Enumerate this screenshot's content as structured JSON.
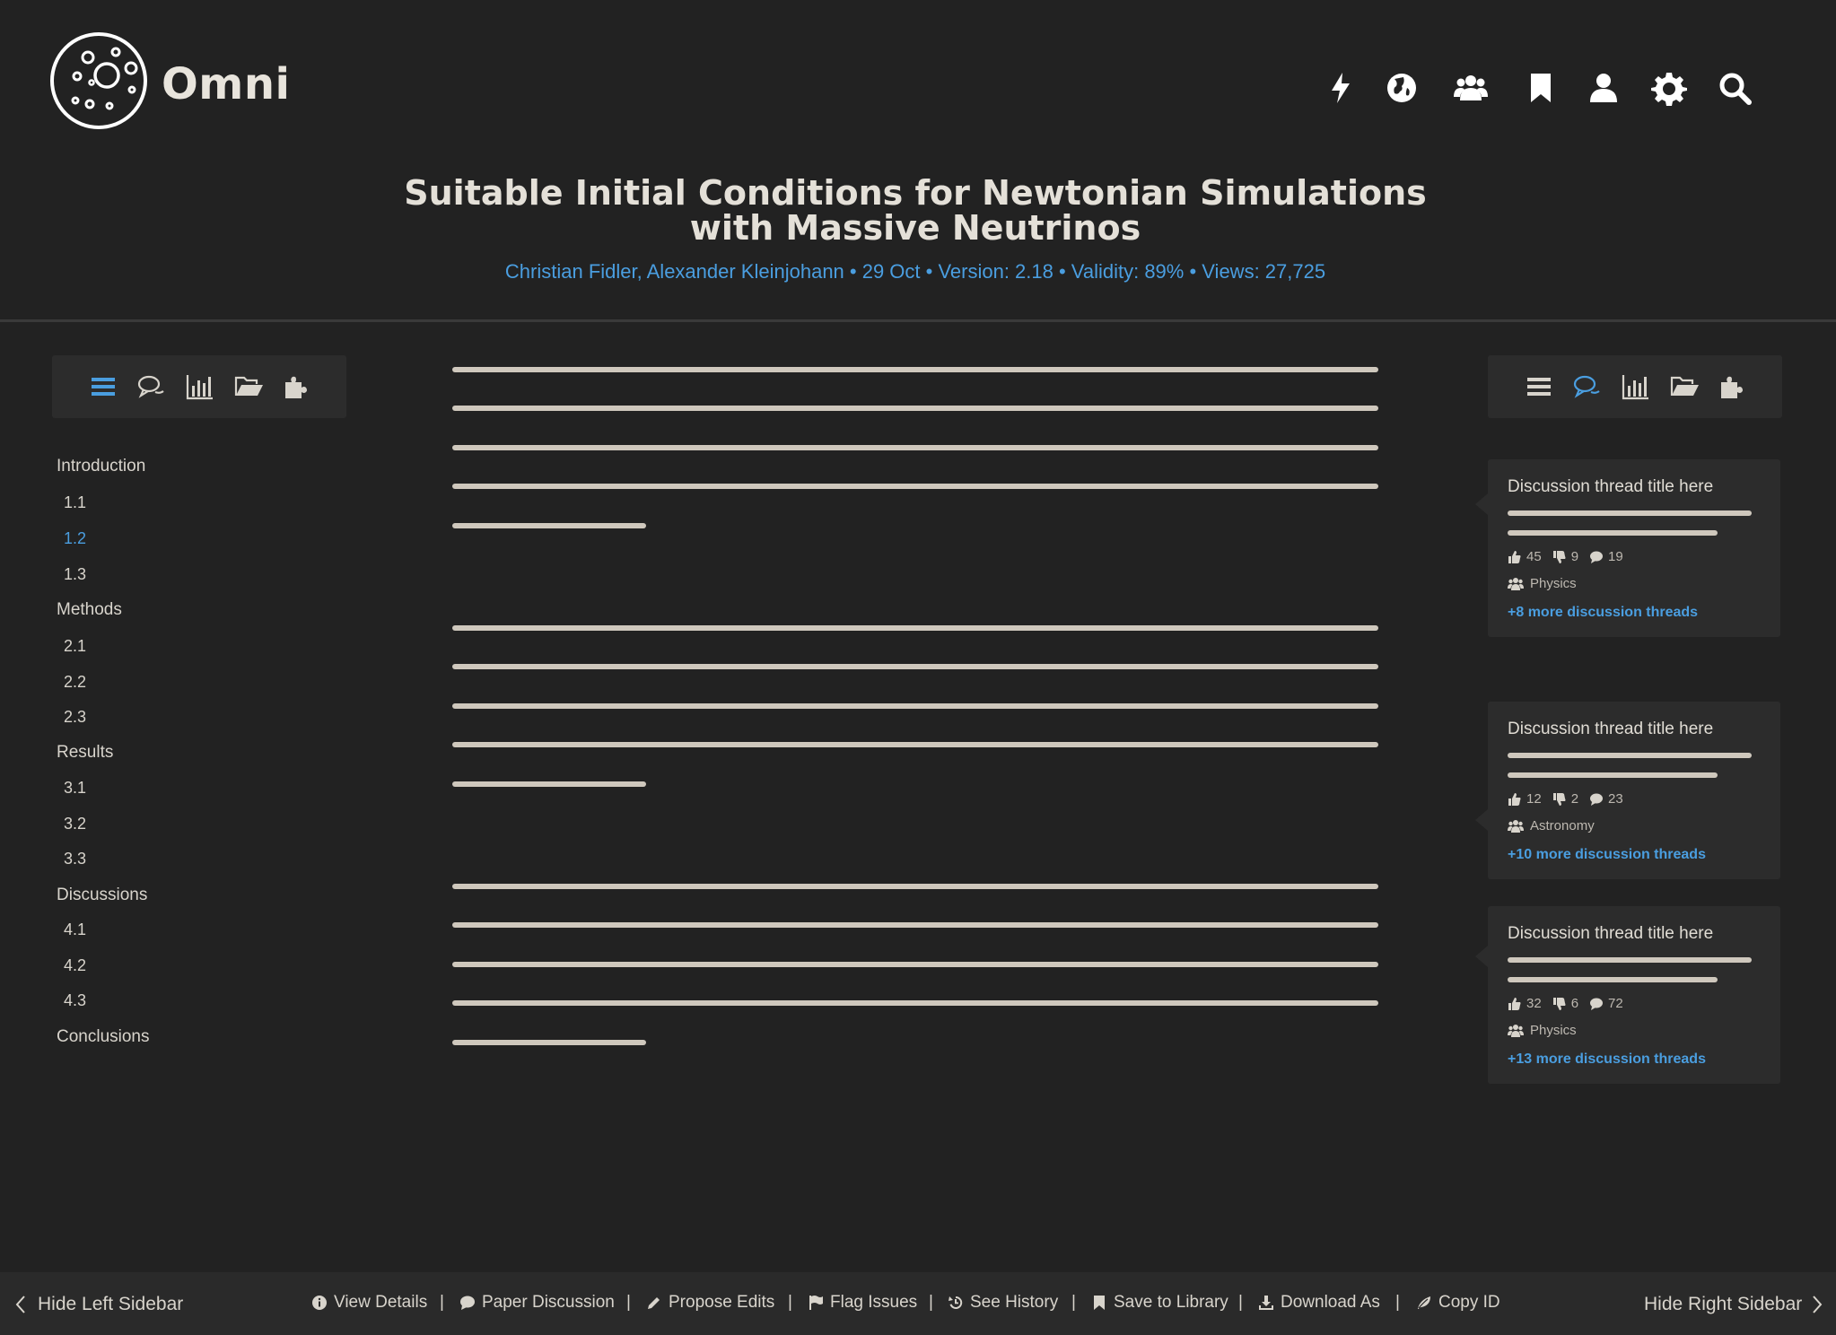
{
  "header": {
    "app_name": "Omni",
    "nav_icons": [
      "bolt-icon",
      "globe-icon",
      "users-icon",
      "bookmark-icon",
      "user-icon",
      "gear-icon",
      "search-icon"
    ]
  },
  "paper": {
    "title_line1": "Suitable Initial Conditions for Newtonian Simulations",
    "title_line2": "with Massive Neutrinos",
    "meta": "Christian Fidler, Alexander Kleinjohann • 29 Oct • Version: 2.18 • Validity: 89% • Views: 27,725"
  },
  "left_toolbar": {
    "icons": [
      "list-icon",
      "comments-icon",
      "bar-chart-icon",
      "folder-open-icon",
      "puzzle-icon"
    ],
    "active": "list-icon"
  },
  "right_toolbar": {
    "icons": [
      "list-icon",
      "comments-icon",
      "bar-chart-icon",
      "folder-open-icon",
      "puzzle-icon"
    ],
    "active": "comments-icon"
  },
  "toc": {
    "items": [
      {
        "label": "Introduction",
        "level": 0
      },
      {
        "label": "1.1",
        "level": 1
      },
      {
        "label": "1.2",
        "level": 1,
        "active": true
      },
      {
        "label": "1.3",
        "level": 1
      },
      {
        "label": "Methods",
        "level": 0
      },
      {
        "label": "2.1",
        "level": 1
      },
      {
        "label": "2.2",
        "level": 1
      },
      {
        "label": "2.3",
        "level": 1
      },
      {
        "label": "Results",
        "level": 0
      },
      {
        "label": "3.1",
        "level": 1
      },
      {
        "label": "3.2",
        "level": 1
      },
      {
        "label": "3.3",
        "level": 1
      },
      {
        "label": "Discussions",
        "level": 0
      },
      {
        "label": "4.1",
        "level": 1
      },
      {
        "label": "4.2",
        "level": 1
      },
      {
        "label": "4.3",
        "level": 1
      },
      {
        "label": "Conclusions",
        "level": 0
      }
    ]
  },
  "discussions": [
    {
      "title": "Discussion thread title here",
      "upvotes": "45",
      "downvotes": "9",
      "comments": "19",
      "topic": "Physics",
      "more": "+8 more discussion threads"
    },
    {
      "title": "Discussion thread title here",
      "upvotes": "12",
      "downvotes": "2",
      "comments": "23",
      "topic": "Astronomy",
      "more": "+10 more discussion threads"
    },
    {
      "title": "Discussion thread title here",
      "upvotes": "32",
      "downvotes": "6",
      "comments": "72",
      "topic": "Physics",
      "more": "+13 more discussion threads"
    }
  ],
  "footer": {
    "hide_left": "Hide Left Sidebar",
    "hide_right": "Hide Right Sidebar",
    "actions": [
      {
        "label": "View Details",
        "icon": "info-icon"
      },
      {
        "label": "Paper Discussion",
        "icon": "comment-icon"
      },
      {
        "label": "Propose Edits",
        "icon": "pencil-icon"
      },
      {
        "label": "Flag Issues",
        "icon": "flag-icon"
      },
      {
        "label": "See History",
        "icon": "history-icon"
      },
      {
        "label": "Save to Library",
        "icon": "bookmark-icon"
      },
      {
        "label": "Download As",
        "icon": "download-icon"
      },
      {
        "label": "Copy ID",
        "icon": "leaf-icon"
      }
    ]
  },
  "colors": {
    "background": "#222222",
    "accent": "#4a9ee0",
    "text": "#d8d4cc",
    "panel": "#2c2c2c"
  }
}
